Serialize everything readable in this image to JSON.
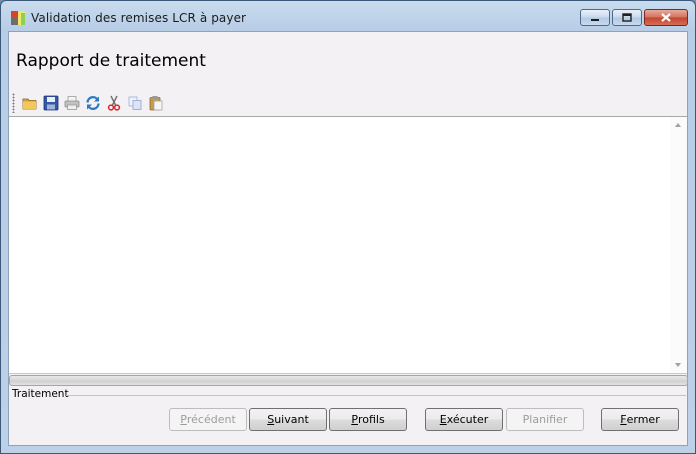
{
  "window": {
    "title": "Validation des remises LCR à payer"
  },
  "page": {
    "title": "Rapport de traitement"
  },
  "toolbar": {
    "icons": [
      "open-folder-icon",
      "save-icon",
      "print-icon",
      "refresh-icon",
      "cut-icon",
      "copy-icon",
      "paste-icon"
    ]
  },
  "report": {
    "content": ""
  },
  "progress": {
    "value": 0
  },
  "status": {
    "label": "Traitement"
  },
  "buttons": {
    "previous": {
      "first": "P",
      "rest": "récédent",
      "enabled": false
    },
    "next": {
      "first": "S",
      "rest": "uivant",
      "enabled": true
    },
    "profiles": {
      "first": "P",
      "rest": "rofils",
      "enabled": true
    },
    "execute": {
      "first": "E",
      "rest": "xécuter",
      "enabled": true
    },
    "schedule": {
      "first": "P",
      "rest": "lanifier",
      "enabled": false
    },
    "close": {
      "first": "F",
      "rest": "ermer",
      "enabled": true
    }
  }
}
